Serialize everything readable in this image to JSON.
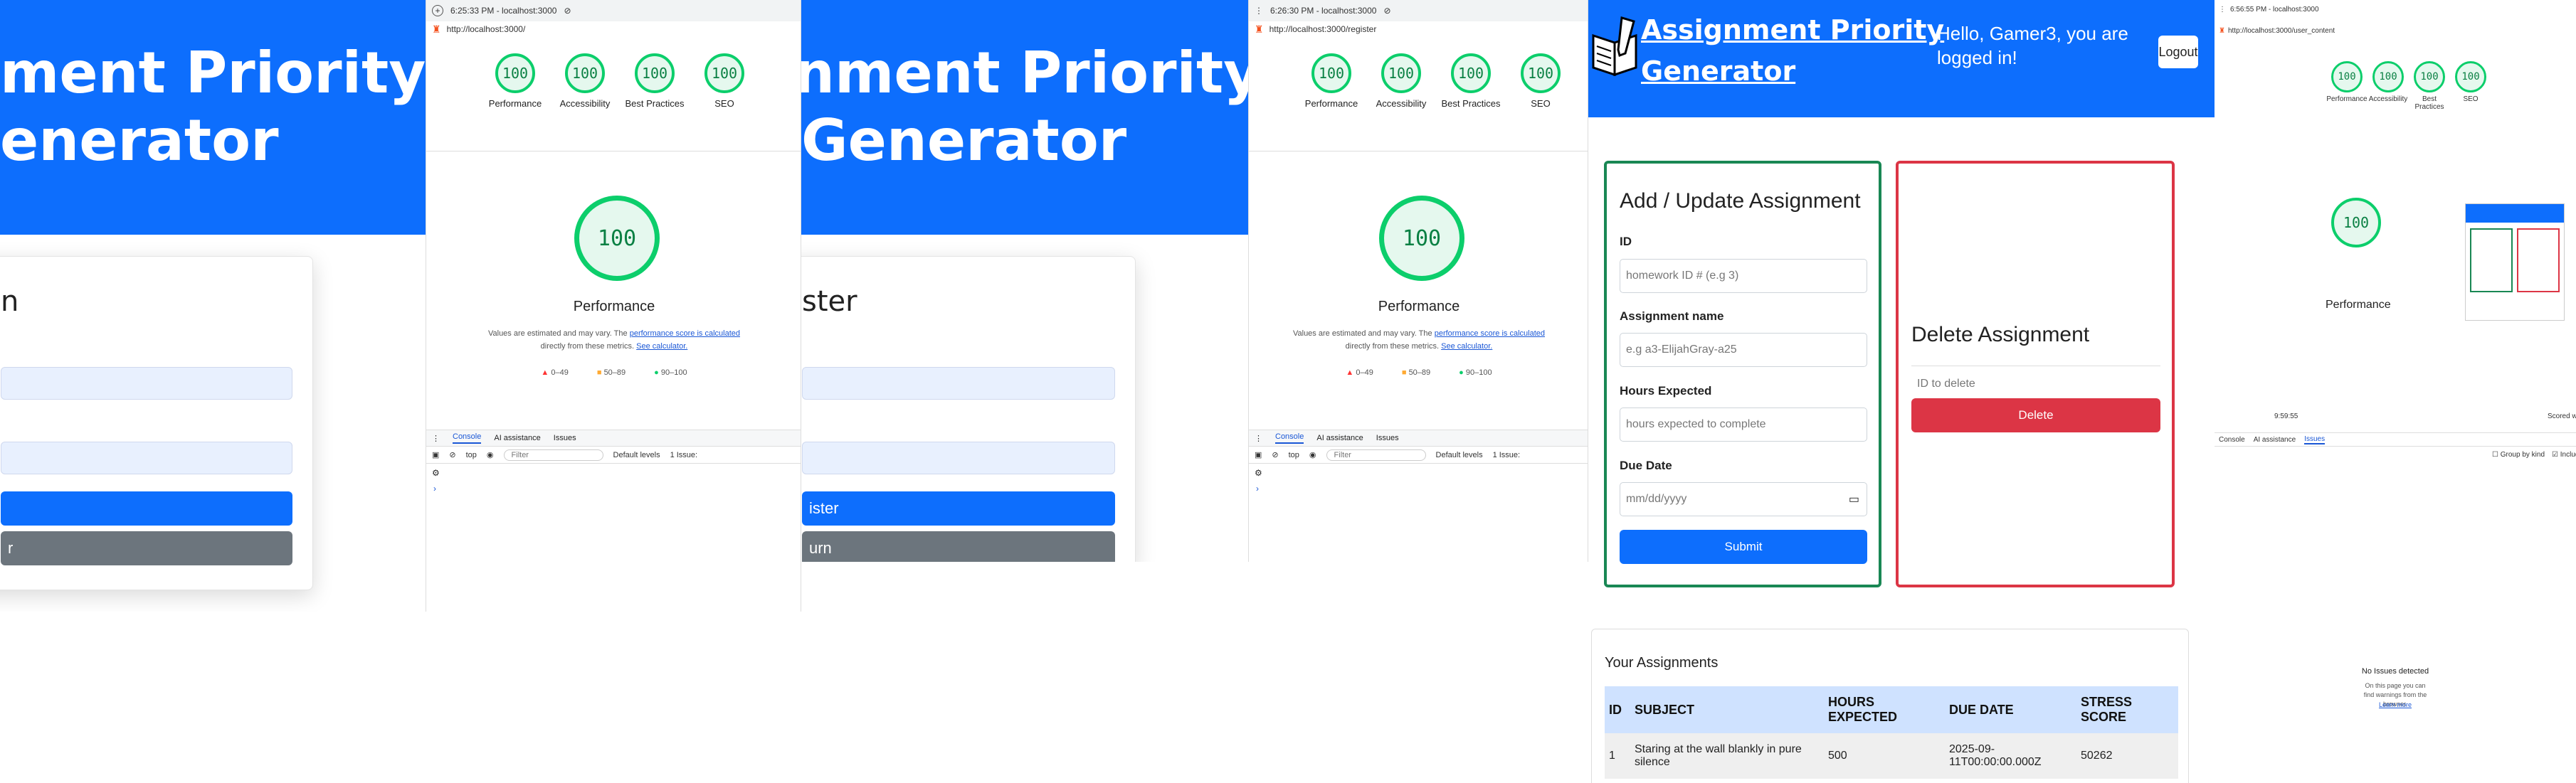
{
  "login_bg": {
    "title_line1": "ment Priority",
    "title_line2": "enerator",
    "card_title": "n",
    "btn_primary": "",
    "btn_secondary": "r"
  },
  "register_bg": {
    "title_line1": "nment Priority",
    "title_line2": "Generator",
    "card_title": "ster",
    "btn_primary": "ister",
    "btn_secondary": "urn"
  },
  "devtools1": {
    "time": "6:25:33 PM - localhost:3000",
    "url": "http://localhost:3000/",
    "scores": [
      {
        "value": "100",
        "label": "Performance"
      },
      {
        "value": "100",
        "label": "Accessibility"
      },
      {
        "value": "100",
        "label": "Best Practices"
      },
      {
        "value": "100",
        "label": "SEO"
      }
    ],
    "big_score": "100",
    "big_label": "Performance",
    "note_prefix": "Values are estimated and may vary. The",
    "note_link1": "performance score is calculated",
    "note_mid": "directly from these metrics.",
    "note_link2": "See calculator.",
    "legend": [
      "0–49",
      "50–89",
      "90–100"
    ],
    "tabs": [
      "Console",
      "AI assistance",
      "Issues"
    ],
    "toolbar": {
      "context": "top",
      "filter": "Filter",
      "levels": "Default levels",
      "issues": "1 Issue:"
    }
  },
  "devtools2": {
    "time": "6:26:30 PM - localhost:3000",
    "url": "http://localhost:3000/register",
    "scores": [
      {
        "value": "100",
        "label": "Performance"
      },
      {
        "value": "100",
        "label": "Accessibility"
      },
      {
        "value": "100",
        "label": "Best Practices"
      },
      {
        "value": "100",
        "label": "SEO"
      }
    ],
    "big_score": "100",
    "big_label": "Performance",
    "note_prefix": "Values are estimated and may vary. The",
    "note_link1": "performance score is calculated",
    "note_mid": "directly from these metrics.",
    "note_link2": "See calculator.",
    "legend": [
      "0–49",
      "50–89",
      "90–100"
    ],
    "tabs": [
      "Console",
      "AI assistance",
      "Issues"
    ],
    "toolbar": {
      "context": "top",
      "filter": "Filter",
      "levels": "Default levels",
      "issues": "1 Issue:"
    }
  },
  "app": {
    "logo_line1": "Assignment Priority",
    "logo_line2": "Generator",
    "greeting": "Hello, Gamer3, you are logged in!",
    "logout": "Logout",
    "form": {
      "title": "Add / Update Assignment",
      "id_label": "ID",
      "id_placeholder": "homework ID # (e.g 3)",
      "name_label": "Assignment name",
      "name_placeholder": "e.g a3-ElijahGray-a25",
      "hours_label": "Hours Expected",
      "hours_placeholder": "hours expected to complete",
      "due_label": "Due Date",
      "due_placeholder": "mm/dd/yyyy",
      "submit": "Submit"
    },
    "delete": {
      "title": "Delete Assignment",
      "placeholder": "ID to delete",
      "button": "Delete"
    },
    "table": {
      "title": "Your Assignments",
      "headers": [
        "ID",
        "SUBJECT",
        "HOURS EXPECTED",
        "DUE DATE",
        "STRESS SCORE"
      ],
      "rows": [
        [
          "1",
          "Staring at the wall blankly in pure silence",
          "500",
          "2025-09-11T00:00:00.000Z",
          "50262"
        ]
      ]
    }
  },
  "devtools3": {
    "time": "6:56:55 PM - localhost:3000",
    "url": "http://localhost:3000/user_content",
    "scores": [
      {
        "value": "100",
        "label": "Performance"
      },
      {
        "value": "100",
        "label": "Accessibility"
      },
      {
        "value": "100",
        "label": "Best Practices"
      },
      {
        "value": "100",
        "label": "SEO"
      }
    ],
    "big_score": "100",
    "big_label": "Performance",
    "timing": "9:59:55",
    "trail": "Scored wi",
    "tabs": [
      "Console",
      "AI assistance",
      "Issues"
    ],
    "group": "Group by kind",
    "include": "Include third",
    "no_issues": "No Issues detected",
    "no_issues_sub": "On this page you can find warnings from the browser.",
    "learn_more": "Learn more"
  }
}
